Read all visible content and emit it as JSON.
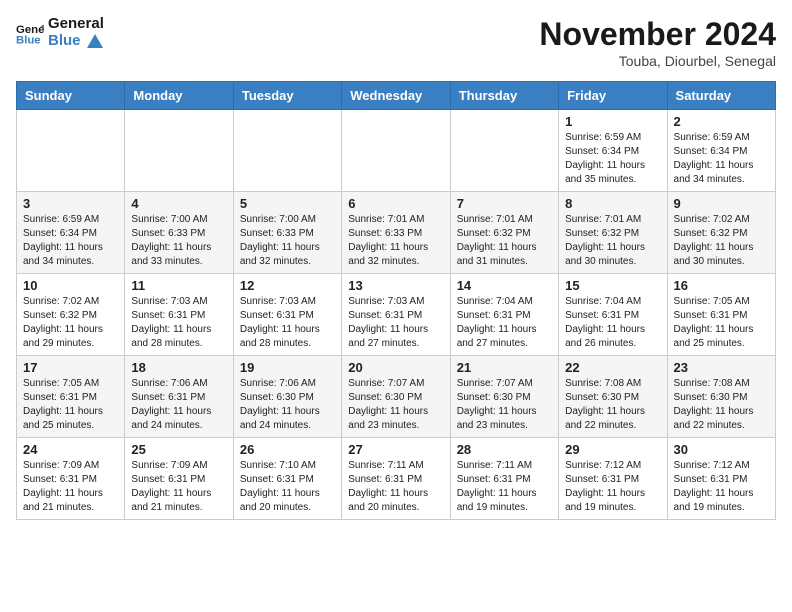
{
  "header": {
    "logo_line1": "General",
    "logo_line2": "Blue",
    "month_title": "November 2024",
    "location": "Touba, Diourbel, Senegal"
  },
  "days_of_week": [
    "Sunday",
    "Monday",
    "Tuesday",
    "Wednesday",
    "Thursday",
    "Friday",
    "Saturday"
  ],
  "weeks": [
    [
      {
        "day": "",
        "info": ""
      },
      {
        "day": "",
        "info": ""
      },
      {
        "day": "",
        "info": ""
      },
      {
        "day": "",
        "info": ""
      },
      {
        "day": "",
        "info": ""
      },
      {
        "day": "1",
        "info": "Sunrise: 6:59 AM\nSunset: 6:34 PM\nDaylight: 11 hours\nand 35 minutes."
      },
      {
        "day": "2",
        "info": "Sunrise: 6:59 AM\nSunset: 6:34 PM\nDaylight: 11 hours\nand 34 minutes."
      }
    ],
    [
      {
        "day": "3",
        "info": "Sunrise: 6:59 AM\nSunset: 6:34 PM\nDaylight: 11 hours\nand 34 minutes."
      },
      {
        "day": "4",
        "info": "Sunrise: 7:00 AM\nSunset: 6:33 PM\nDaylight: 11 hours\nand 33 minutes."
      },
      {
        "day": "5",
        "info": "Sunrise: 7:00 AM\nSunset: 6:33 PM\nDaylight: 11 hours\nand 32 minutes."
      },
      {
        "day": "6",
        "info": "Sunrise: 7:01 AM\nSunset: 6:33 PM\nDaylight: 11 hours\nand 32 minutes."
      },
      {
        "day": "7",
        "info": "Sunrise: 7:01 AM\nSunset: 6:32 PM\nDaylight: 11 hours\nand 31 minutes."
      },
      {
        "day": "8",
        "info": "Sunrise: 7:01 AM\nSunset: 6:32 PM\nDaylight: 11 hours\nand 30 minutes."
      },
      {
        "day": "9",
        "info": "Sunrise: 7:02 AM\nSunset: 6:32 PM\nDaylight: 11 hours\nand 30 minutes."
      }
    ],
    [
      {
        "day": "10",
        "info": "Sunrise: 7:02 AM\nSunset: 6:32 PM\nDaylight: 11 hours\nand 29 minutes."
      },
      {
        "day": "11",
        "info": "Sunrise: 7:03 AM\nSunset: 6:31 PM\nDaylight: 11 hours\nand 28 minutes."
      },
      {
        "day": "12",
        "info": "Sunrise: 7:03 AM\nSunset: 6:31 PM\nDaylight: 11 hours\nand 28 minutes."
      },
      {
        "day": "13",
        "info": "Sunrise: 7:03 AM\nSunset: 6:31 PM\nDaylight: 11 hours\nand 27 minutes."
      },
      {
        "day": "14",
        "info": "Sunrise: 7:04 AM\nSunset: 6:31 PM\nDaylight: 11 hours\nand 27 minutes."
      },
      {
        "day": "15",
        "info": "Sunrise: 7:04 AM\nSunset: 6:31 PM\nDaylight: 11 hours\nand 26 minutes."
      },
      {
        "day": "16",
        "info": "Sunrise: 7:05 AM\nSunset: 6:31 PM\nDaylight: 11 hours\nand 25 minutes."
      }
    ],
    [
      {
        "day": "17",
        "info": "Sunrise: 7:05 AM\nSunset: 6:31 PM\nDaylight: 11 hours\nand 25 minutes."
      },
      {
        "day": "18",
        "info": "Sunrise: 7:06 AM\nSunset: 6:31 PM\nDaylight: 11 hours\nand 24 minutes."
      },
      {
        "day": "19",
        "info": "Sunrise: 7:06 AM\nSunset: 6:30 PM\nDaylight: 11 hours\nand 24 minutes."
      },
      {
        "day": "20",
        "info": "Sunrise: 7:07 AM\nSunset: 6:30 PM\nDaylight: 11 hours\nand 23 minutes."
      },
      {
        "day": "21",
        "info": "Sunrise: 7:07 AM\nSunset: 6:30 PM\nDaylight: 11 hours\nand 23 minutes."
      },
      {
        "day": "22",
        "info": "Sunrise: 7:08 AM\nSunset: 6:30 PM\nDaylight: 11 hours\nand 22 minutes."
      },
      {
        "day": "23",
        "info": "Sunrise: 7:08 AM\nSunset: 6:30 PM\nDaylight: 11 hours\nand 22 minutes."
      }
    ],
    [
      {
        "day": "24",
        "info": "Sunrise: 7:09 AM\nSunset: 6:31 PM\nDaylight: 11 hours\nand 21 minutes."
      },
      {
        "day": "25",
        "info": "Sunrise: 7:09 AM\nSunset: 6:31 PM\nDaylight: 11 hours\nand 21 minutes."
      },
      {
        "day": "26",
        "info": "Sunrise: 7:10 AM\nSunset: 6:31 PM\nDaylight: 11 hours\nand 20 minutes."
      },
      {
        "day": "27",
        "info": "Sunrise: 7:11 AM\nSunset: 6:31 PM\nDaylight: 11 hours\nand 20 minutes."
      },
      {
        "day": "28",
        "info": "Sunrise: 7:11 AM\nSunset: 6:31 PM\nDaylight: 11 hours\nand 19 minutes."
      },
      {
        "day": "29",
        "info": "Sunrise: 7:12 AM\nSunset: 6:31 PM\nDaylight: 11 hours\nand 19 minutes."
      },
      {
        "day": "30",
        "info": "Sunrise: 7:12 AM\nSunset: 6:31 PM\nDaylight: 11 hours\nand 19 minutes."
      }
    ]
  ]
}
